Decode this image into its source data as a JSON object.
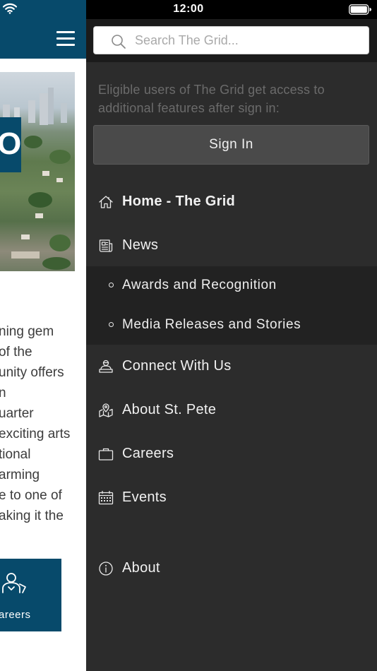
{
  "status_bar": {
    "time": "12:00"
  },
  "background_page": {
    "hero_letter": "O",
    "paragraph_lines": [
      "ning gem",
      " of the",
      "unity offers",
      "n",
      "uarter",
      "exciting arts",
      "tional",
      "arming",
      "e to one of",
      "aking it the"
    ],
    "careers_tile_label": "areers",
    "brand_color": "#074a6b"
  },
  "drawer": {
    "search": {
      "placeholder": "Search The Grid..."
    },
    "signin_hint": "Eligible users of The Grid get access to additional features after sign in:",
    "signin_button": "Sign In",
    "nav": {
      "home": "Home - The Grid",
      "news": "News",
      "news_sub": [
        "Awards and Recognition",
        "Media Releases and Stories"
      ],
      "connect": "Connect With Us",
      "about_st_pete": "About St. Pete",
      "careers": "Careers",
      "events": "Events",
      "about": "About"
    },
    "icons": {
      "home": "home-icon",
      "news": "newspaper-icon",
      "connect": "person-desk-icon",
      "about_st_pete": "map-pin-icon",
      "careers": "briefcase-icon",
      "events": "calendar-icon",
      "about": "info-icon"
    },
    "colors": {
      "drawer_bg": "#2c2c2c",
      "search_area_bg": "#1b1b1b",
      "submenu_bg": "#222222",
      "button_bg": "#4a4a4a"
    }
  }
}
